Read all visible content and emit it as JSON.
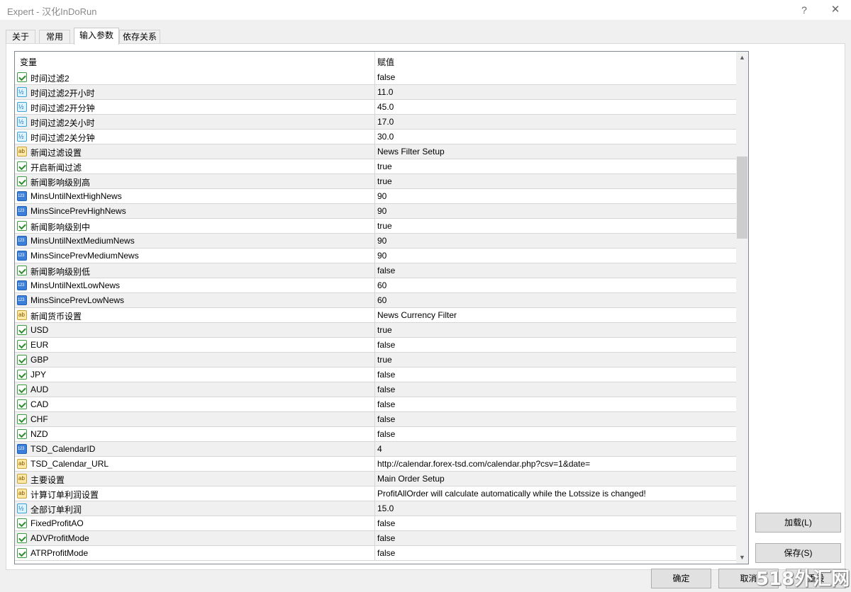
{
  "window": {
    "title": "Expert - 汉化InDoRun",
    "help_glyph": "?",
    "close_glyph": "✕"
  },
  "tabs": [
    {
      "label": "关于",
      "active": false
    },
    {
      "label": "常用",
      "active": false
    },
    {
      "label": "输入参数",
      "active": true
    },
    {
      "label": "依存关系",
      "active": false
    }
  ],
  "grid": {
    "columns": {
      "variable": "变量",
      "value": "赋值"
    },
    "rows": [
      {
        "type": "bool",
        "name": "时间过滤2",
        "value": "false"
      },
      {
        "type": "double",
        "name": "时间过滤2开小时",
        "value": "11.0"
      },
      {
        "type": "double",
        "name": "时间过滤2开分钟",
        "value": "45.0"
      },
      {
        "type": "double",
        "name": "时间过滤2关小时",
        "value": "17.0"
      },
      {
        "type": "double",
        "name": "时间过滤2关分钟",
        "value": "30.0"
      },
      {
        "type": "string",
        "name": "新闻过滤设置",
        "value": "News Filter Setup"
      },
      {
        "type": "bool",
        "name": "开启新闻过滤",
        "value": "true"
      },
      {
        "type": "bool",
        "name": "新闻影响级别高",
        "value": "true"
      },
      {
        "type": "int",
        "name": "MinsUntilNextHighNews",
        "value": "90"
      },
      {
        "type": "int",
        "name": "MinsSincePrevHighNews",
        "value": "90"
      },
      {
        "type": "bool",
        "name": "新闻影响级别中",
        "value": "true"
      },
      {
        "type": "int",
        "name": "MinsUntilNextMediumNews",
        "value": "90"
      },
      {
        "type": "int",
        "name": "MinsSincePrevMediumNews",
        "value": "90"
      },
      {
        "type": "bool",
        "name": "新闻影响级别低",
        "value": "false"
      },
      {
        "type": "int",
        "name": "MinsUntilNextLowNews",
        "value": "60"
      },
      {
        "type": "int",
        "name": "MinsSincePrevLowNews",
        "value": "60"
      },
      {
        "type": "string",
        "name": "新闻货币设置",
        "value": "News Currency Filter"
      },
      {
        "type": "bool",
        "name": "USD",
        "value": "true"
      },
      {
        "type": "bool",
        "name": "EUR",
        "value": "false"
      },
      {
        "type": "bool",
        "name": "GBP",
        "value": "true"
      },
      {
        "type": "bool",
        "name": "JPY",
        "value": "false"
      },
      {
        "type": "bool",
        "name": "AUD",
        "value": "false"
      },
      {
        "type": "bool",
        "name": "CAD",
        "value": "false"
      },
      {
        "type": "bool",
        "name": "CHF",
        "value": "false"
      },
      {
        "type": "bool",
        "name": "NZD",
        "value": "false"
      },
      {
        "type": "int",
        "name": "TSD_CalendarID",
        "value": "4"
      },
      {
        "type": "string",
        "name": "TSD_Calendar_URL",
        "value": "http://calendar.forex-tsd.com/calendar.php?csv=1&date="
      },
      {
        "type": "string",
        "name": "主要设置",
        "value": "Main Order Setup"
      },
      {
        "type": "string",
        "name": "计算订单利润设置",
        "value": " ProfitAllOrder will calculate automatically while the Lotssize is changed!"
      },
      {
        "type": "double",
        "name": "全部订单利润",
        "value": "15.0"
      },
      {
        "type": "bool",
        "name": "FixedProfitAO",
        "value": "false"
      },
      {
        "type": "bool",
        "name": "ADVProfitMode",
        "value": "false"
      },
      {
        "type": "bool",
        "name": "ATRProfitMode",
        "value": "false"
      }
    ]
  },
  "buttons": {
    "load": "加载(L)",
    "save": "保存(S)",
    "ok": "确定",
    "cancel": "取消",
    "reset": "重设"
  },
  "watermark": "518外汇网"
}
